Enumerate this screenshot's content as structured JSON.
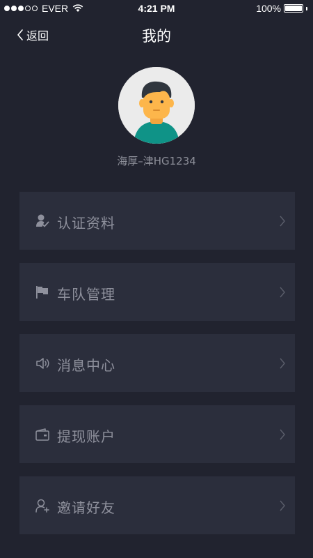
{
  "status_bar": {
    "carrier": "EVER",
    "time": "4:21 PM",
    "battery": "100%",
    "battery_level": 1.0,
    "signal_bars_filled": 3,
    "signal_bars_total": 5
  },
  "nav": {
    "back_label": "返回",
    "title": "我的"
  },
  "profile": {
    "username": "海厚–津HG1234"
  },
  "menu": {
    "items": [
      {
        "label": "认证资料",
        "icon": "user-verify-icon"
      },
      {
        "label": "车队管理",
        "icon": "flag-icon"
      },
      {
        "label": "消息中心",
        "icon": "speaker-icon"
      },
      {
        "label": "提现账户",
        "icon": "wallet-icon"
      },
      {
        "label": "邀请好友",
        "icon": "add-user-icon"
      }
    ]
  },
  "colors": {
    "background": "#21232f",
    "menu_item_bg": "#2b2e3c",
    "menu_text": "#8e909c",
    "avatar_bg": "#ebebeb",
    "avatar_shirt": "#0f9387",
    "avatar_skin": "#fdb64b",
    "avatar_hair": "#30363e"
  }
}
